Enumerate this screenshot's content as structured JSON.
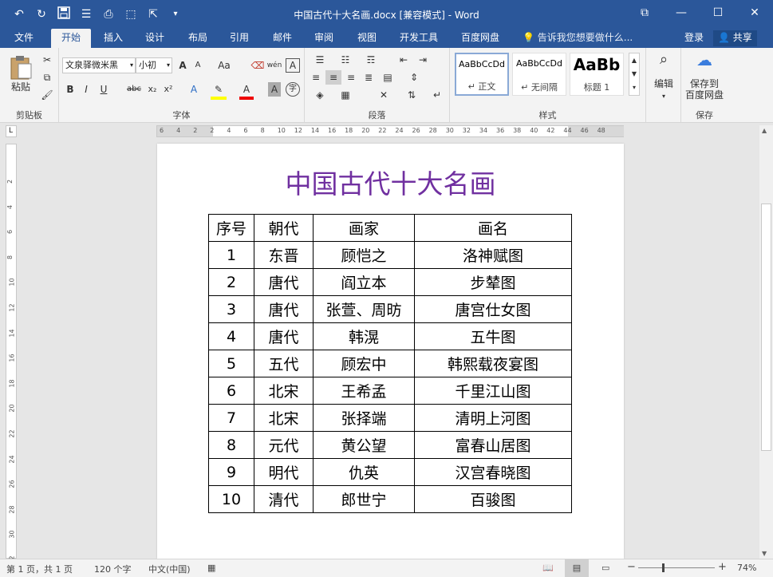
{
  "window": {
    "title": "中国古代十大名画.docx [兼容模式] - Word",
    "qat_icons": [
      "undo-icon",
      "redo-icon",
      "save-icon",
      "touch-mode-icon",
      "print-preview-icon",
      "format-painter-icon",
      "selection-icon",
      "customize-qat-icon"
    ],
    "controls": [
      "ribbon-display-options-icon",
      "minimize-icon",
      "maximize-icon",
      "close-icon"
    ]
  },
  "tabs": {
    "file": "文件",
    "home": "开始",
    "insert": "插入",
    "design": "设计",
    "layout": "布局",
    "references": "引用",
    "mailings": "邮件",
    "review": "审阅",
    "view": "视图",
    "developer": "开发工具",
    "baidu": "百度网盘",
    "tellme": "告诉我您想要做什么...",
    "login": "登录",
    "share": "共享"
  },
  "ribbon": {
    "clipboard": {
      "paste": "粘贴",
      "label": "剪贴板"
    },
    "font": {
      "name": "文泉驿微米黑",
      "size": "小初",
      "label": "字体",
      "grow": "A",
      "shrink": "A",
      "change_case": "Aa",
      "bold": "B",
      "italic": "I",
      "underline": "U",
      "strikethrough": "abc",
      "subscript": "x₂",
      "superscript": "x²",
      "text_effect": "A",
      "font_color": "A",
      "char_shading": "A",
      "enclose": "字",
      "phonetic": "wén",
      "char_border": "A"
    },
    "paragraph": {
      "label": "段落"
    },
    "styles": {
      "label": "样式",
      "items": [
        {
          "preview": "AaBbCcDd",
          "name": "↵ 正文"
        },
        {
          "preview": "AaBbCcDd",
          "name": "↵ 无间隔"
        },
        {
          "preview": "AaBb",
          "name": "标题 1"
        }
      ]
    },
    "editing": {
      "label": "编辑"
    },
    "save": {
      "label1": "保存到",
      "label2": "百度网盘",
      "group": "保存"
    }
  },
  "ruler": {
    "h_labels": [
      "6",
      "4",
      "2",
      "2",
      "4",
      "6",
      "8",
      "10",
      "12",
      "14",
      "16",
      "18",
      "20",
      "22",
      "24",
      "26",
      "28",
      "30",
      "32",
      "34",
      "36",
      "38",
      "40",
      "42",
      "44",
      "46",
      "48"
    ],
    "v_labels": [
      "2",
      "4",
      "6",
      "8",
      "10",
      "12",
      "14",
      "16",
      "18",
      "20",
      "22",
      "24",
      "26",
      "28",
      "30",
      "32"
    ],
    "corner": "L"
  },
  "document": {
    "heading": "中国古代十大名画",
    "headers": [
      "序号",
      "朝代",
      "画家",
      "画名"
    ],
    "rows": [
      [
        "1",
        "东晋",
        "顾恺之",
        "洛神赋图"
      ],
      [
        "2",
        "唐代",
        "阎立本",
        "步辇图"
      ],
      [
        "3",
        "唐代",
        "张萱、周昉",
        "唐宫仕女图"
      ],
      [
        "4",
        "唐代",
        "韩滉",
        "五牛图"
      ],
      [
        "5",
        "五代",
        "顾宏中",
        "韩熙载夜宴图"
      ],
      [
        "6",
        "北宋",
        "王希孟",
        "千里江山图"
      ],
      [
        "7",
        "北宋",
        "张择端",
        "清明上河图"
      ],
      [
        "8",
        "元代",
        "黄公望",
        "富春山居图"
      ],
      [
        "9",
        "明代",
        "仇英",
        "汉宫春晓图"
      ],
      [
        "10",
        "清代",
        "郎世宁",
        "百骏图"
      ]
    ]
  },
  "status": {
    "page": "第 1 页，共 1 页",
    "words": "120 个字",
    "language": "中文(中国)",
    "zoom": "74%",
    "zoom_minus": "−",
    "zoom_plus": "+"
  },
  "colors": {
    "brand": "#2b579a",
    "heading": "#7030a0"
  }
}
